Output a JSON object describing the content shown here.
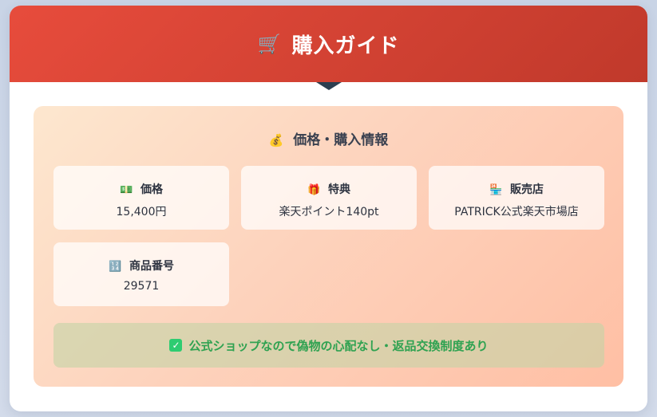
{
  "header": {
    "icon": "shopping-cart-icon",
    "title": "購入ガイド"
  },
  "panel": {
    "icon": "money-bag-icon",
    "title": "価格・購入情報",
    "items": [
      {
        "icon": "banknote-icon",
        "label": "価格",
        "value": "15,400円"
      },
      {
        "icon": "gift-icon",
        "label": "特典",
        "value": "楽天ポイント140pt"
      },
      {
        "icon": "store-icon",
        "label": "販売店",
        "value": "PATRICK公式楽天市場店"
      },
      {
        "icon": "number-input-icon",
        "label": "商品番号",
        "value": "29571"
      }
    ],
    "note": {
      "icon": "check-box-icon",
      "text": "公式ショップなので偽物の心配なし・返品交換制度あり"
    }
  },
  "colors": {
    "header_gradient_start": "#e74c3c",
    "header_gradient_end": "#c0392b",
    "note_text": "#2fa251",
    "note_icon": "#2ecc71",
    "page_background": "#c9d4e6"
  }
}
